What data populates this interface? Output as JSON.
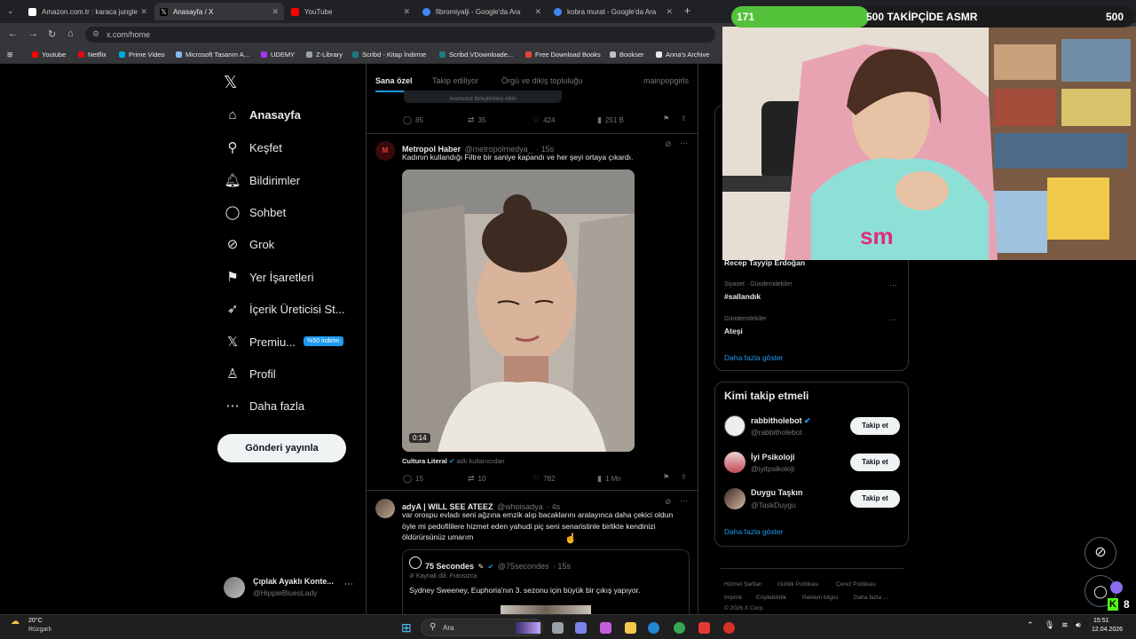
{
  "browser": {
    "tabs": [
      {
        "title": "Amazon.com.tr : karaca jungle",
        "active": false,
        "color": "#ffffff"
      },
      {
        "title": "Anasayfa / X",
        "active": true,
        "color": "#e7e9ea"
      },
      {
        "title": "YouTube",
        "active": false,
        "color": "#ff0000"
      },
      {
        "title": "fibromiyalji - Google'da Ara",
        "active": false,
        "color": "#4285f4"
      },
      {
        "title": "kobra murat - Google'da Ara",
        "active": false,
        "color": "#4285f4"
      }
    ],
    "new_tab": "+",
    "url": "x.com/home",
    "bookmarks": [
      "Youtube",
      "Netflix",
      "Prime Video",
      "Microsoft Tasarım A...",
      "UDEMY",
      "Z-Library",
      "Scribd - Kitap İndirme",
      "Scribd.VDownloade...",
      "Free Download Books",
      "Bookser",
      "Anna's Archive"
    ]
  },
  "x": {
    "logo": "𝕏",
    "nav": [
      {
        "label": "Anasayfa",
        "icon": "home-icon",
        "glyph": "⌂"
      },
      {
        "label": "Keşfet",
        "icon": "search-icon",
        "glyph": "⚲"
      },
      {
        "label": "Bildirimler",
        "icon": "bell-icon",
        "glyph": "🔔︎"
      },
      {
        "label": "Sohbet",
        "icon": "chat-icon",
        "glyph": "◯"
      },
      {
        "label": "Grok",
        "icon": "grok-icon",
        "glyph": "⊘"
      },
      {
        "label": "Yer İşaretleri",
        "icon": "bookmark-icon",
        "glyph": "⚑"
      },
      {
        "label": "İçerik Üreticisi St...",
        "icon": "rocket-icon",
        "glyph": "➶"
      },
      {
        "label": "Premiu...",
        "icon": "x-premium-icon",
        "glyph": "𝕏"
      },
      {
        "label": "Profil",
        "icon": "profile-icon",
        "glyph": "♙"
      },
      {
        "label": "Daha fazla",
        "icon": "more-icon",
        "glyph": "⋯"
      }
    ],
    "premium_badge": "%50 indirim",
    "post_button": "Gönderi yayınla",
    "account": {
      "name": "Çıplak Ayaklı Konte...",
      "handle": "@HippieBluesLady"
    },
    "feed_tabs": [
      "Sana özel",
      "Takip ediliyor",
      "Örgü ve dikiş topluluğu",
      "mainpopgirls"
    ],
    "top_hint": "Anımsınız birleştiriklesi etkin",
    "first_stats": {
      "replies": "85",
      "reposts": "35",
      "likes": "424",
      "views": "251 B"
    },
    "tweet1": {
      "name": "Metropol Haber",
      "handle": "@metropolmedya_",
      "time": "· 15s",
      "text": "Kadının kullandığı Filtre bir saniye kapandı ve her şeyi ortaya çıkardı.",
      "video_time": "0:14",
      "credit": "Cultura Literal",
      "credit_suffix": "adlı kullanıcıdan",
      "stats": {
        "replies": "15",
        "reposts": "10",
        "likes": "782",
        "views": "1 Mn"
      }
    },
    "tweet2": {
      "name": "adyA | WILL SEE ATEEZ",
      "handle": "@whoisadya",
      "time": "· 4s",
      "text": "var orospu evladı seni ağzına emzik alıp bacaklarını aralayınca daha çekici oldun öyle mi pedofililere hizmet eden yahudi piç seni senaristinle birlikte kendinizi öldürürsünüz umarım",
      "quote": {
        "name": "75 Secondes",
        "handle": "@75secondes",
        "time": "· 15s",
        "source": "Kaynak dili: Fransızca",
        "text": "Sydney Sweeney, Euphoria'nın 3. sezonu için büyük bir çıkış yapıyor."
      }
    },
    "trends": [
      {
        "category": "",
        "name": "Recep Tayyip Erdoğan"
      },
      {
        "category": "Siyaset · Gündemdekiler",
        "name": "#sallandık"
      },
      {
        "category": "Gündemdekiler",
        "name": "Ateşi"
      }
    ],
    "show_more": "Daha fazla göster",
    "who_to_follow": {
      "title": "Kimi takip etmeli",
      "users": [
        {
          "name": "rabbitholebot",
          "handle": "@rabbitholebot",
          "verified": true,
          "button": "Takip et"
        },
        {
          "name": "İyi Psikoloji",
          "handle": "@iyitpsikoloji",
          "verified": false,
          "button": "Takip et"
        },
        {
          "name": "Duygu Taşkın",
          "handle": "@TaskDuygu",
          "verified": false,
          "button": "Takip et"
        }
      ],
      "show_more": "Daha fazla göster"
    },
    "footer": [
      "Hizmet Şartları",
      "Gizlilik Politikası",
      "Çerez Politikası",
      "Imprint",
      "Erişilebilirlik",
      "Reklam bilgisi",
      "Daha fazla ...",
      "© 2026 X Corp."
    ]
  },
  "stream": {
    "current_followers": "171",
    "goal_text": "500 TAKİPÇİDE ASMR",
    "goal_target": "500",
    "progress_fraction": 0.342,
    "kick_count": "8"
  },
  "taskbar": {
    "weather_temp": "20°C",
    "weather_label": "Rüzgarlı",
    "search_placeholder": "Ara",
    "time": "15:51",
    "date": "12.04.2026"
  },
  "colors": {
    "accent": "#1d9bf0",
    "progress": "#53c23a",
    "kick": "#53fc18"
  }
}
